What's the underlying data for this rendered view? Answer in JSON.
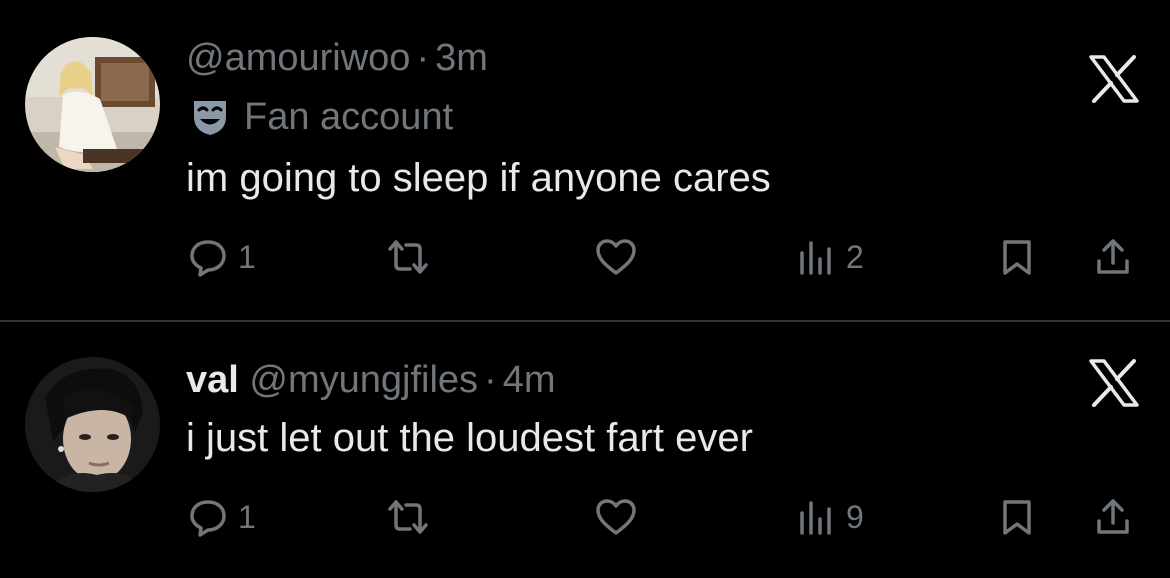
{
  "posts": [
    {
      "handle": "@amouriwoo",
      "separator": "·",
      "time": "3m",
      "label": "Fan account",
      "label_icon": "theater-mask-icon",
      "text": "im going to sleep if anyone cares",
      "replies": "1",
      "views": "2"
    },
    {
      "display_name": "val",
      "handle": "@myungjfiles",
      "separator": "·",
      "time": "4m",
      "text": "i just let out the loudest fart ever",
      "replies": "1",
      "views": "9"
    }
  ],
  "colors": {
    "background": "#000000",
    "primary_text": "#e7e9ea",
    "secondary_text": "#71767b",
    "divider": "#2f3336",
    "label_icon": "#8b98a5"
  }
}
